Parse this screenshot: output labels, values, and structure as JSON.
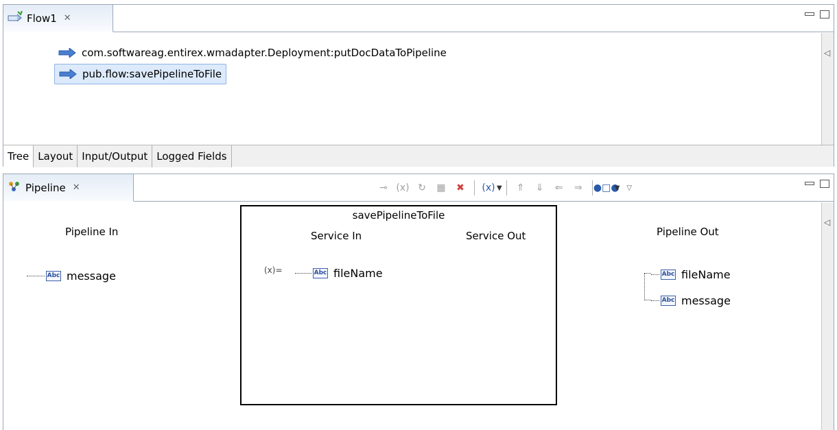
{
  "flow_view": {
    "tab_title": "Flow1",
    "tab_icon": "flow-icon",
    "close_icon": "close-icon",
    "steps": [
      {
        "label": "com.softwareag.entirex.wmadapter.Deployment:putDocDataToPipeline",
        "icon": "invoke-arrow-icon",
        "selected": false
      },
      {
        "label": "pub.flow:savePipelineToFile",
        "icon": "invoke-arrow-icon",
        "selected": true
      }
    ],
    "bottom_tabs": [
      "Tree",
      "Layout",
      "Input/Output",
      "Logged Fields"
    ],
    "active_tab": "Tree"
  },
  "pipeline_view": {
    "tab_title": "Pipeline",
    "tab_icon": "pipeline-icon",
    "toolbar_icons": [
      "link-icon",
      "set-value-icon",
      "transform-icon",
      "map-icon",
      "delete-icon",
      "pipeline-vars-icon",
      "shift-up-icon",
      "shift-down-icon",
      "shift-left-icon",
      "shift-right-icon",
      "view-mode-icon"
    ],
    "pipeline_in": {
      "heading": "Pipeline In",
      "vars": [
        {
          "name": "message",
          "type_icon": "Abc"
        }
      ]
    },
    "service": {
      "name": "savePipelineToFile",
      "service_in_heading": "Service In",
      "service_out_heading": "Service Out",
      "in_vars": [
        {
          "name": "fileName",
          "type_icon": "Abc"
        }
      ],
      "set_value_marker": "(x)="
    },
    "pipeline_out": {
      "heading": "Pipeline Out",
      "vars": [
        {
          "name": "fileName",
          "type_icon": "Abc"
        },
        {
          "name": "message",
          "type_icon": "Abc"
        }
      ]
    }
  }
}
